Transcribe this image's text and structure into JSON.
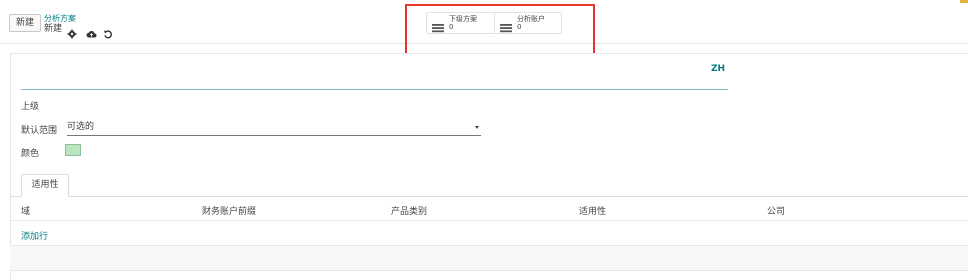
{
  "control_panel": {
    "new_button": "新建",
    "breadcrumb": "分析方案",
    "record_name": "新建",
    "icons": [
      "gear-icon",
      "cloud-upload-icon",
      "undo-icon"
    ]
  },
  "smart_buttons": [
    {
      "label": "下级方案",
      "count": "0",
      "icon": "list-icon"
    },
    {
      "label": "分析账户",
      "count": "0",
      "icon": "list-icon"
    }
  ],
  "form": {
    "language": "ZH",
    "parent_label": "上级",
    "default_scope_label": "默认范围",
    "default_scope_value": "可选的",
    "color_label": "颜色",
    "color_value": "#b9e6c1"
  },
  "tabs": [
    "适用性"
  ],
  "table": {
    "headers": [
      "域",
      "财务账户前缀",
      "产品类别",
      "适用性",
      "公司"
    ],
    "add_line": "添加行"
  },
  "colors": {
    "accent": "#017e84",
    "highlight": "#e8332b"
  }
}
